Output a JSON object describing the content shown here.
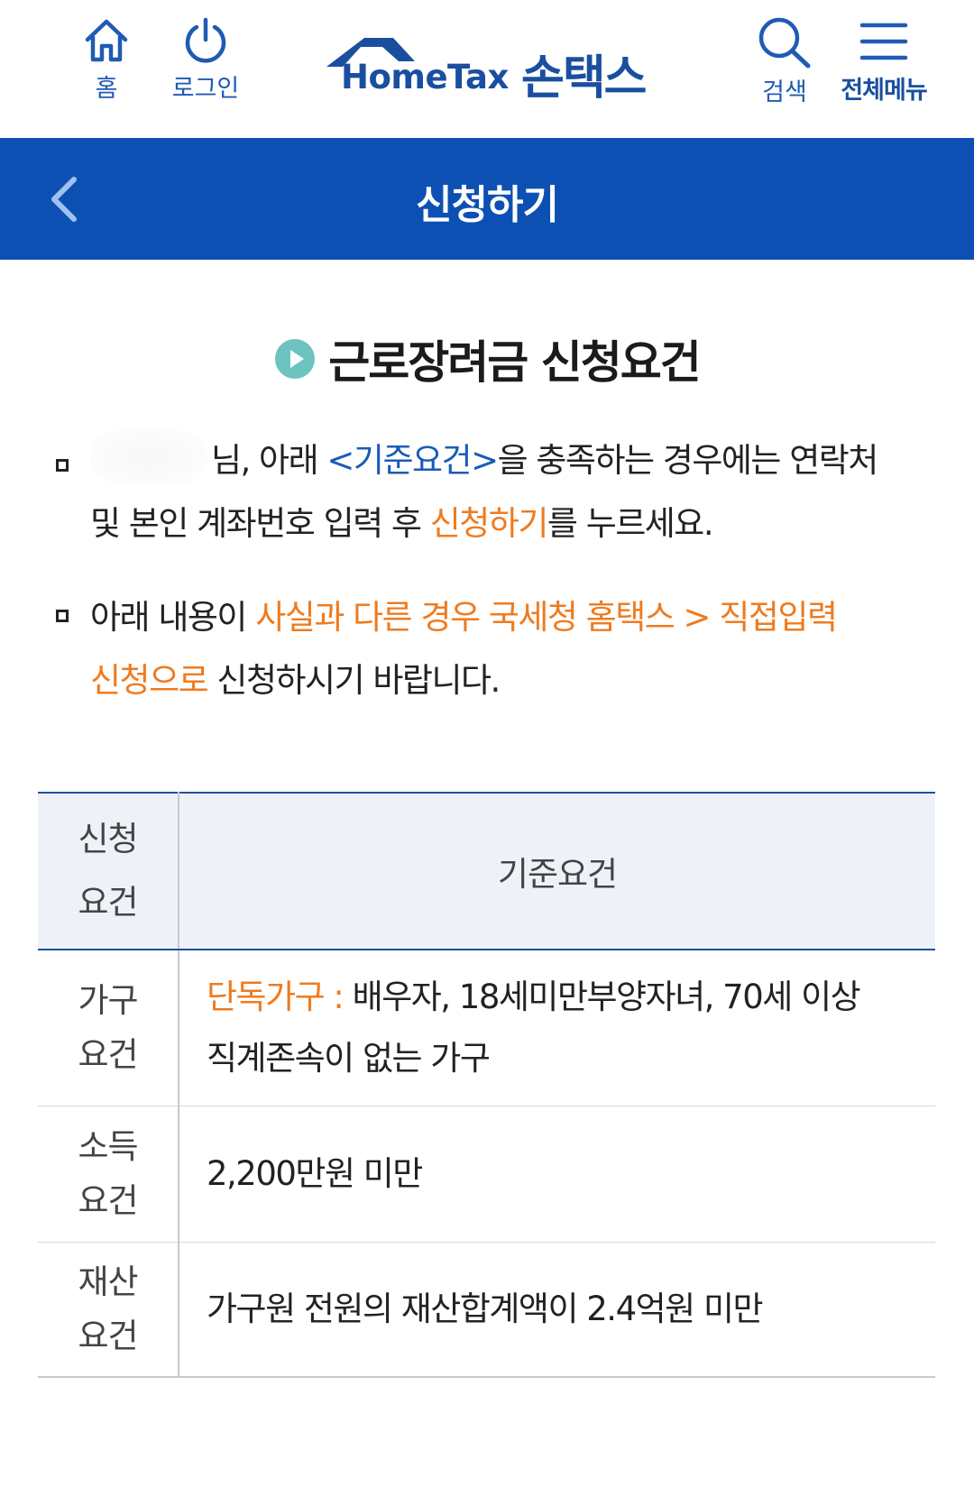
{
  "header": {
    "home_label": "홈",
    "login_label": "로그인",
    "brand_en": "HomeTax",
    "brand_ko": "손택스",
    "search_label": "검색",
    "menu_label": "전체메뉴"
  },
  "title_bar": {
    "title": "신청하기"
  },
  "section": {
    "heading": "근로장려금 신청요건"
  },
  "notice1": {
    "name_suffix": "님, 아래 ",
    "criteria_link": "<기준요건>",
    "text_a": "을 충족하는 경우에는 연락처",
    "text_b": "및 본인 계좌번호 입력 후 ",
    "apply_word": "신청하기",
    "text_c": "를 누르세요."
  },
  "notice2": {
    "text_a": "아래 내용이 ",
    "highlight_a": "사실과 다른 경우 국세청 홈택스 > 직접입력",
    "highlight_b": "신청으로",
    "text_b": " 신청하시기 바랍니다."
  },
  "table": {
    "header_col1_line1": "신청",
    "header_col1_line2": "요건",
    "header_col2": "기준요건",
    "rows": [
      {
        "label_line1": "가구",
        "label_line2": "요건",
        "highlight": "단독가구 : ",
        "value_line1": "배우자, 18세미만부양자녀, 70세 이상",
        "value_line2": "직계존속이 없는 가구"
      },
      {
        "label_line1": "소득",
        "label_line2": "요건",
        "value": "2,200만원 미만"
      },
      {
        "label_line1": "재산",
        "label_line2": "요건",
        "value": "가구원 전원의 재산합계액이 2.4억원 미만"
      }
    ]
  },
  "colors": {
    "brand_blue": "#1a4fa0",
    "title_bar_bg": "#0d50b4",
    "link_blue": "#1a5bb8",
    "highlight_orange": "#ef7b1f",
    "play_icon_teal": "#6cc3c0"
  },
  "icons": {
    "home": "home-icon",
    "login": "power-icon",
    "search": "search-icon",
    "menu": "hamburger-icon",
    "back": "chevron-left-icon",
    "heading": "play-circle-icon"
  }
}
